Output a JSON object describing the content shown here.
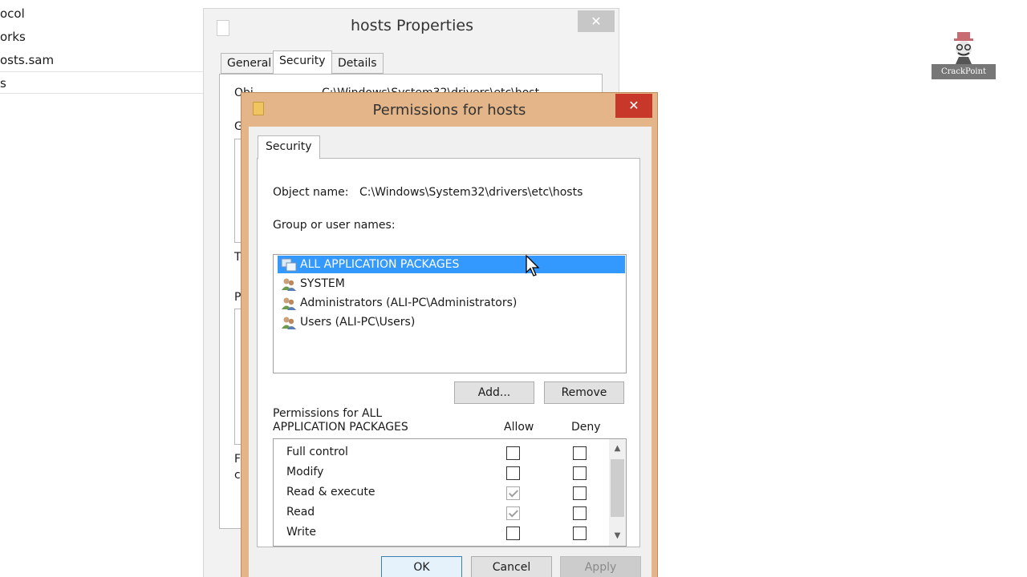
{
  "explorer": {
    "items": [
      "ocol",
      "orks",
      "osts.sam",
      "s"
    ]
  },
  "props_window": {
    "title": "hosts Properties",
    "close_label": "✕",
    "tabs": [
      "General",
      "Security",
      "Details"
    ],
    "active_tab": "Security",
    "peek_fragments": [
      "Obj",
      "C:\\Windows\\System32\\drivers\\etc\\host",
      "G",
      "T",
      "P",
      "F",
      "c"
    ]
  },
  "perm_dialog": {
    "title": "Permissions for hosts",
    "close_label": "✕",
    "tab": "Security",
    "object_name_label": "Object name:",
    "object_name_value": "C:\\Windows\\System32\\drivers\\etc\\hosts",
    "group_label": "Group or user names:",
    "users": [
      {
        "name": "ALL APPLICATION PACKAGES",
        "selected": true,
        "icon": "app-packages-icon"
      },
      {
        "name": "SYSTEM",
        "selected": false,
        "icon": "users-icon"
      },
      {
        "name": "Administrators (ALI-PC\\Administrators)",
        "selected": false,
        "icon": "users-icon"
      },
      {
        "name": "Users (ALI-PC\\Users)",
        "selected": false,
        "icon": "users-icon"
      }
    ],
    "add_label": "Add...",
    "remove_label": "Remove",
    "permissions_for_line1": "Permissions for ALL",
    "permissions_for_line2": "APPLICATION PACKAGES",
    "allow_header": "Allow",
    "deny_header": "Deny",
    "permissions": [
      {
        "name": "Full control",
        "allow": false,
        "deny": false
      },
      {
        "name": "Modify",
        "allow": false,
        "deny": false
      },
      {
        "name": "Read & execute",
        "allow": true,
        "deny": false
      },
      {
        "name": "Read",
        "allow": true,
        "deny": false
      },
      {
        "name": "Write",
        "allow": false,
        "deny": false
      }
    ],
    "ok_label": "OK",
    "cancel_label": "Cancel",
    "apply_label": "Apply"
  },
  "logo": {
    "text": "CrackPoint"
  },
  "colors": {
    "selection": "#3399ff",
    "dialog_frame": "#e3b589",
    "close_red": "#c8382a"
  }
}
